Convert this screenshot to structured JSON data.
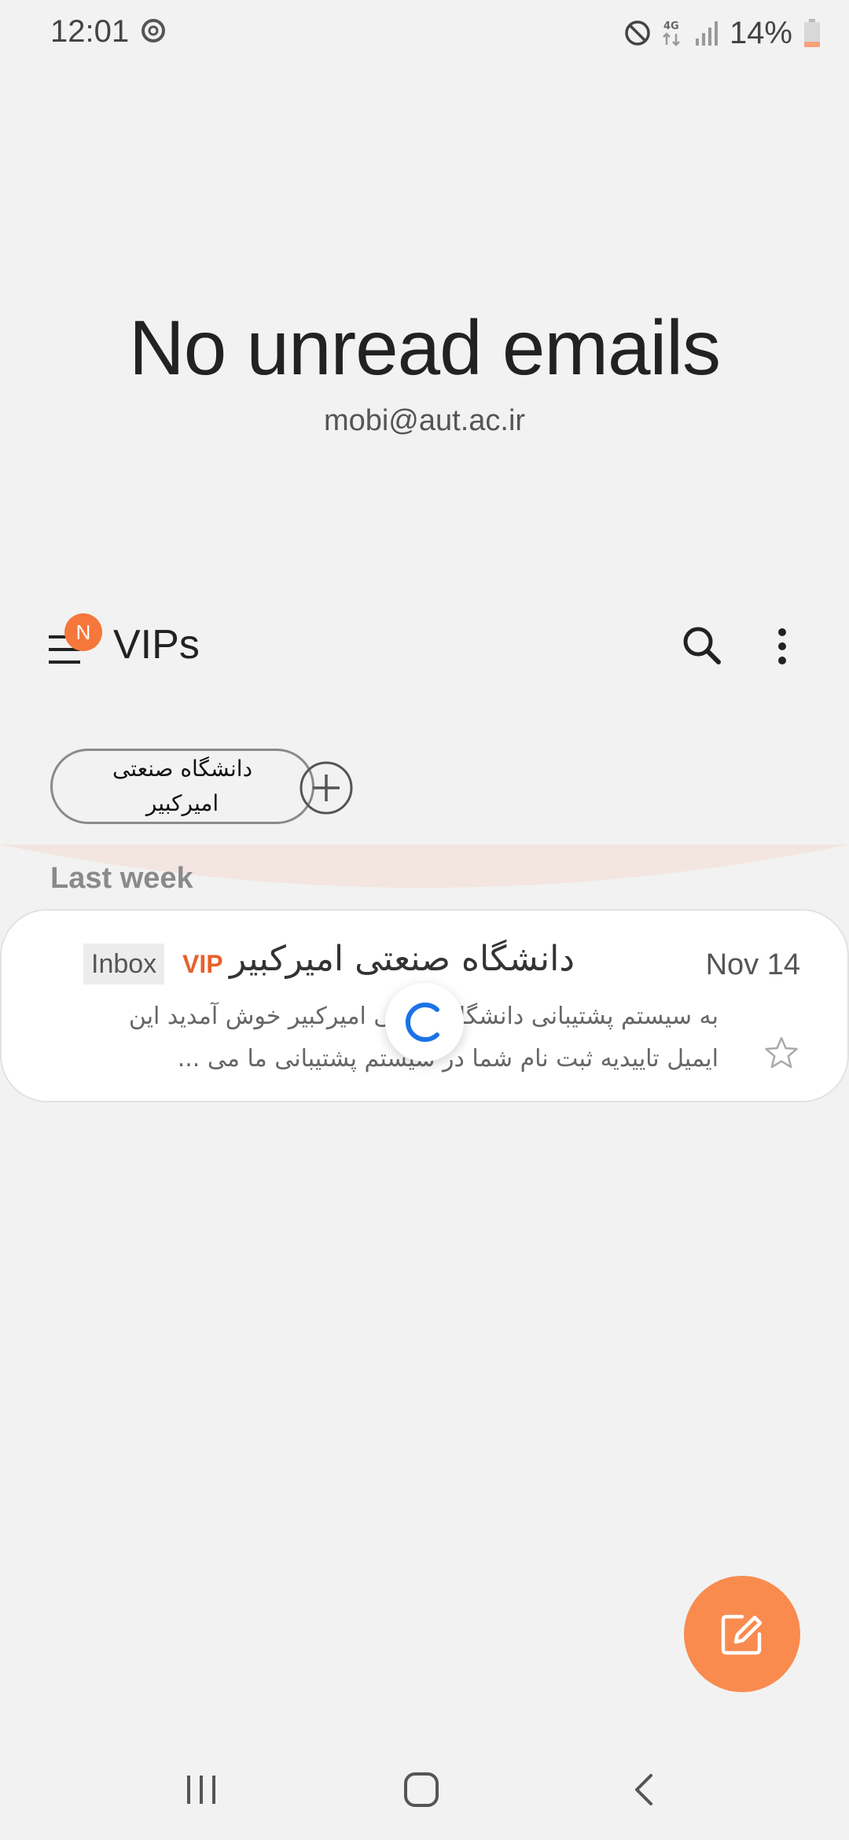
{
  "status_bar": {
    "time": "12:01",
    "network": "4G",
    "battery_percent": "14%",
    "icons": [
      "sync-icon",
      "do-not-disturb-icon",
      "network-4g-icon",
      "signal-icon",
      "battery-icon"
    ]
  },
  "hero": {
    "title": "No unread emails",
    "account": "mobi@aut.ac.ir"
  },
  "toolbar": {
    "badge": "N",
    "title": "VIPs",
    "icons": [
      "menu-icon",
      "search-icon",
      "more-vert-icon"
    ]
  },
  "vip_chips": [
    {
      "label": "دانشگاه صنعتی امیرکبیر"
    }
  ],
  "section": {
    "label": "Last week"
  },
  "emails": [
    {
      "folder": "Inbox",
      "vip_tag": "VIP",
      "sender": "دانشگاه صنعتی امیرکبیر",
      "date": "Nov 14",
      "preview": "به سیستم پشتیبانی دانشگاه صنعتی امیرکبیر خوش آمدید این ایمیل تاییدیه ثبت نام شما در سیستم پشتیبانی ما می ..."
    }
  ],
  "colors": {
    "accent": "#f5773a",
    "fab": "#f98b4f",
    "vip": "#e8602c",
    "spinner": "#1a73e8",
    "background": "#f2f2f2"
  },
  "fab": {
    "icon": "compose-icon"
  },
  "nav_bar": {
    "icons": [
      "recents-icon",
      "home-icon",
      "back-icon"
    ]
  }
}
